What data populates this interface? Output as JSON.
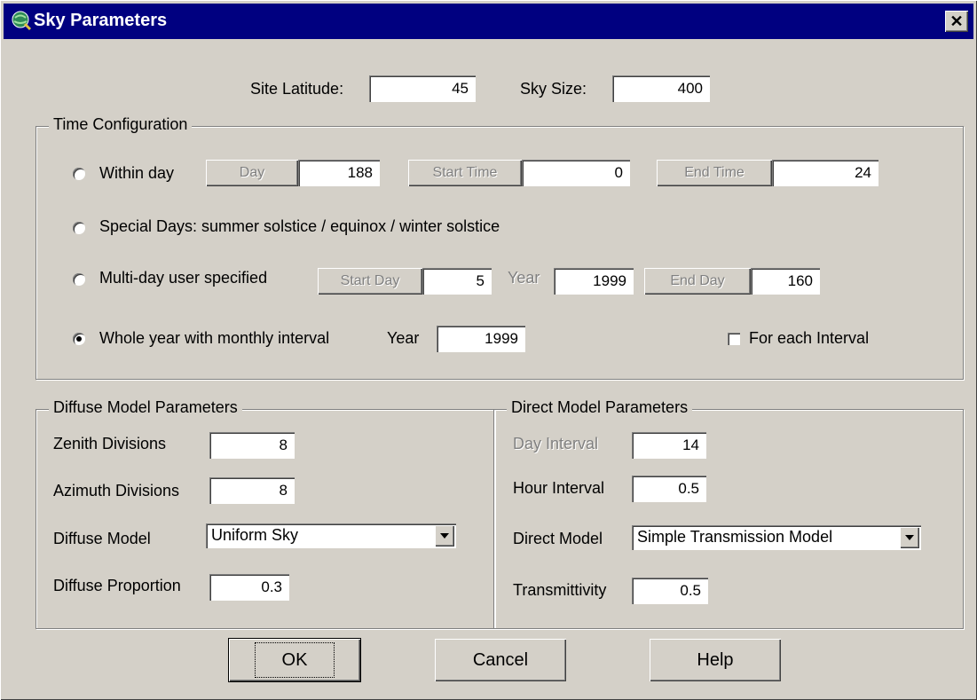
{
  "title": "Sky Parameters",
  "close_glyph": "✕",
  "site_latitude": {
    "label": "Site Latitude:",
    "value": "45"
  },
  "sky_size": {
    "label": "Sky Size:",
    "value": "400"
  },
  "time_config": {
    "title": "Time Configuration",
    "within_day": {
      "label": "Within day",
      "day_btn": "Day",
      "day_value": "188",
      "start_btn": "Start Time",
      "start_value": "0",
      "end_btn": "End Time",
      "end_value": "24"
    },
    "special_days": {
      "label": "Special Days: summer solstice / equinox / winter solstice"
    },
    "multi_day": {
      "label": "Multi-day user specified",
      "start_btn": "Start Day",
      "start_value": "5",
      "year_label": "Year",
      "year_value": "1999",
      "end_btn": "End Day",
      "end_value": "160"
    },
    "whole_year": {
      "label": "Whole year with monthly interval",
      "year_label": "Year",
      "year_value": "1999",
      "selected": true
    },
    "for_each_interval": {
      "label": "For each Interval",
      "checked": false
    }
  },
  "diffuse": {
    "title": "Diffuse Model Parameters",
    "zenith": {
      "label": "Zenith Divisions",
      "value": "8"
    },
    "azimuth": {
      "label": "Azimuth Divisions",
      "value": "8"
    },
    "model": {
      "label": "Diffuse Model",
      "value": "Uniform Sky"
    },
    "proportion": {
      "label": "Diffuse Proportion",
      "value": "0.3"
    }
  },
  "direct": {
    "title": "Direct Model Parameters",
    "day_interval": {
      "label": "Day Interval",
      "value": "14"
    },
    "hour_interval": {
      "label": "Hour Interval",
      "value": "0.5"
    },
    "model": {
      "label": "Direct Model",
      "value": "Simple Transmission Model"
    },
    "transmittivity": {
      "label": "Transmittivity",
      "value": "0.5"
    }
  },
  "buttons": {
    "ok": "OK",
    "cancel": "Cancel",
    "help": "Help"
  }
}
